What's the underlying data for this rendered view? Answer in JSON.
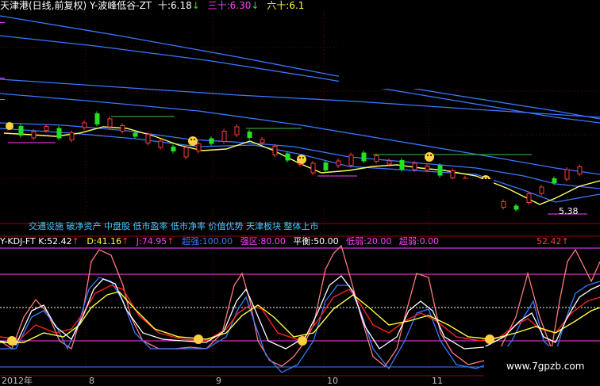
{
  "main_header": {
    "title": "天津港(日线,前复权)",
    "indicator": "Y-波峰低谷-ZT",
    "ma10_label": "十:",
    "ma10_value": "6.18",
    "ma10_arrow": "↓",
    "ma30_label": "三十:",
    "ma30_value": "6.30",
    "ma30_arrow": "↓",
    "ma60_label": "六十:",
    "ma60_value": "6.1"
  },
  "concept_tags": "交通设施 破净资产 中盘股 低市盈率 低市净率 价值优势 天津板块 整体上市",
  "low_price_label": "5.38",
  "kdj_header": {
    "name": "Y-KDJ-FT",
    "k_label": "K:",
    "k_value": "52.42",
    "k_arrow": "↑",
    "d_label": "D:",
    "d_value": "41.16",
    "d_arrow": "↑",
    "j_label": "J:",
    "j_value": "74.95",
    "j_arrow": "↑",
    "overbought_label": "超强:",
    "overbought_value": "100.00",
    "strong_label": "强区:",
    "strong_value": "80.00",
    "balance_label": "平衡:",
    "balance_value": "50.00",
    "weak_label": "低弱:",
    "weak_value": "20.00",
    "oversold_label": "超弱:",
    "oversold_value": "0.00",
    "right_value": "52.42",
    "right_arrow": "↑"
  },
  "date_axis": {
    "year": "2012年",
    "months": [
      "8",
      "9",
      "10",
      "11"
    ]
  },
  "watermark": "www.7gpzb.com",
  "colors": {
    "background": "#000000",
    "up_candle": "#ff3b3b",
    "down_candle": "#22e022",
    "ma_short": "#ffff60",
    "ma_long": "#3a78ff",
    "k_line": "#ffffff",
    "d_line": "#ffff40",
    "j_line": "#ff7a7a",
    "accent_magenta": "#ff40ff"
  }
}
